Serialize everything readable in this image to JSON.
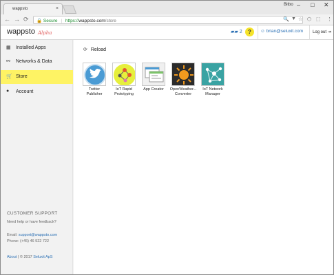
{
  "browser": {
    "tab_title": "wappsto",
    "tab_close": "×",
    "user_label": "Bitbo",
    "window_controls": {
      "minimize": "–",
      "maximize": "□",
      "close": "✕"
    },
    "nav": {
      "back": "←",
      "forward": "→",
      "reload": "⟳"
    },
    "address": {
      "secure": "Secure",
      "separator": "|",
      "scheme": "https://",
      "host": "wappsto.com",
      "path": "/store"
    },
    "toolbar_icons": [
      "🔍",
      "▼",
      "☆",
      "⬡",
      "⬚",
      "⋮"
    ]
  },
  "header": {
    "logo": "wappsto",
    "logo_tag": "Alpha",
    "notifications": "2",
    "help": "?",
    "user_email": "brian@seluxit.com",
    "logout": "Log out"
  },
  "sidebar": {
    "items": [
      {
        "label": "Installed Apps",
        "icon": "grid-icon",
        "glyph": "▦",
        "active": false
      },
      {
        "label": "Networks & Data",
        "icon": "share-icon",
        "glyph": "⚯",
        "active": false
      },
      {
        "label": "Store",
        "icon": "cart-icon",
        "glyph": "🛒",
        "active": true
      },
      {
        "label": "Account",
        "icon": "user-icon",
        "glyph": "●",
        "active": false
      }
    ],
    "support": {
      "title": "CUSTOMER SUPPORT",
      "subtitle": "Need help or have feedback?",
      "email_label": "Email:",
      "email": "support@wappsto.com",
      "phone_label": "Phone:",
      "phone": "(+45) 46 922 722"
    },
    "footer": {
      "about": "About",
      "separator": "|",
      "copyright": "© 2017",
      "company": "Seluxit ApS"
    }
  },
  "main": {
    "reload_label": "Reload",
    "apps": [
      {
        "name": "Twitter Publisher",
        "icon": "twitter-bird-icon",
        "bg": "#4a9bd4"
      },
      {
        "name": "IoT Rapid Prototyping",
        "icon": "iot-prototyping-icon",
        "bg": "#e6ef3c"
      },
      {
        "name": "App Creator",
        "icon": "app-creator-icon",
        "bg": "#f0f0f0"
      },
      {
        "name": "OpenWeather... Converter",
        "icon": "sun-icon",
        "bg": "#2b2b2b"
      },
      {
        "name": "IoT Network Manager",
        "icon": "network-icon",
        "bg": "#3aa3a3"
      }
    ]
  }
}
